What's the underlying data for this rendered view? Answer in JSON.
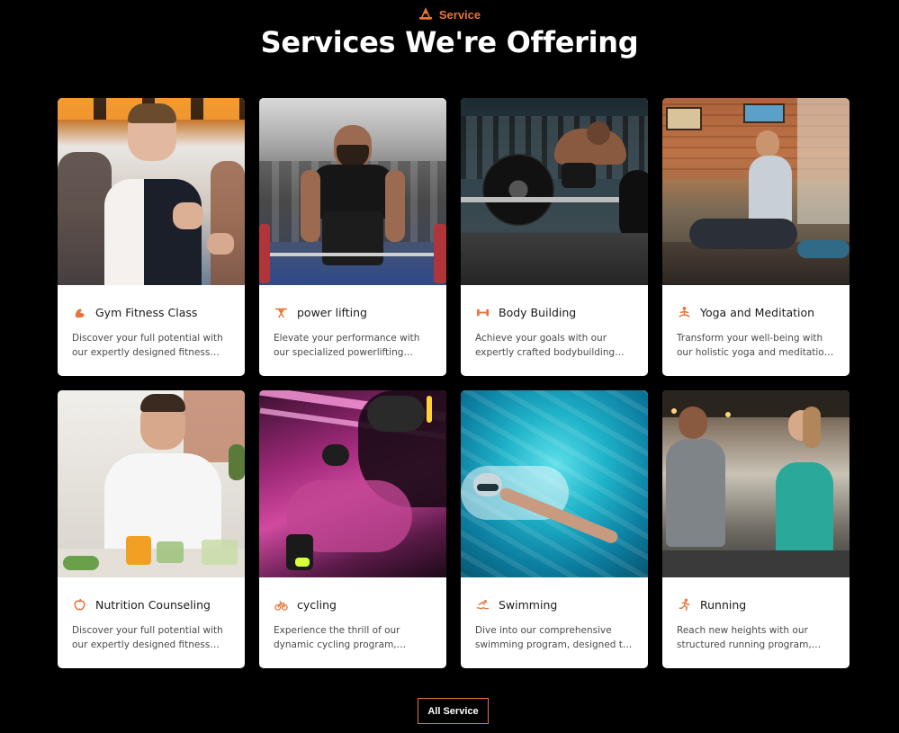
{
  "section": {
    "eyebrow_icon": "dumbbell-logo-icon",
    "eyebrow": "Service",
    "title": "Services We're Offering"
  },
  "accent_color": "#e8743b",
  "services": [
    {
      "icon": "flexed-arm-icon",
      "title": "Gym Fitness Class",
      "description": "Discover your full potential with our expertly designed fitness classes"
    },
    {
      "icon": "weightlifter-icon",
      "title": "power lifting",
      "description": "Elevate your performance with our specialized powerlifting program"
    },
    {
      "icon": "dumbbell-icon",
      "title": "Body Building",
      "description": "Achieve your goals with our expertly crafted bodybuilding program"
    },
    {
      "icon": "meditation-icon",
      "title": "Yoga and Meditation",
      "description": "Transform your well-being with our holistic yoga and meditation sessions"
    },
    {
      "icon": "nutrition-icon",
      "title": "Nutrition Counseling",
      "description": "Discover your full potential with our expertly designed fitness nutrition"
    },
    {
      "icon": "bicycle-icon",
      "title": "cycling",
      "description": "Experience the thrill of our dynamic cycling program, designed for all"
    },
    {
      "icon": "swimmer-icon",
      "title": "Swimming",
      "description": "Dive into our comprehensive swimming program, designed to build skill"
    },
    {
      "icon": "runner-icon",
      "title": "Running",
      "description": "Reach new heights with our structured running program, built for you"
    }
  ],
  "all_service_button": "All Service"
}
